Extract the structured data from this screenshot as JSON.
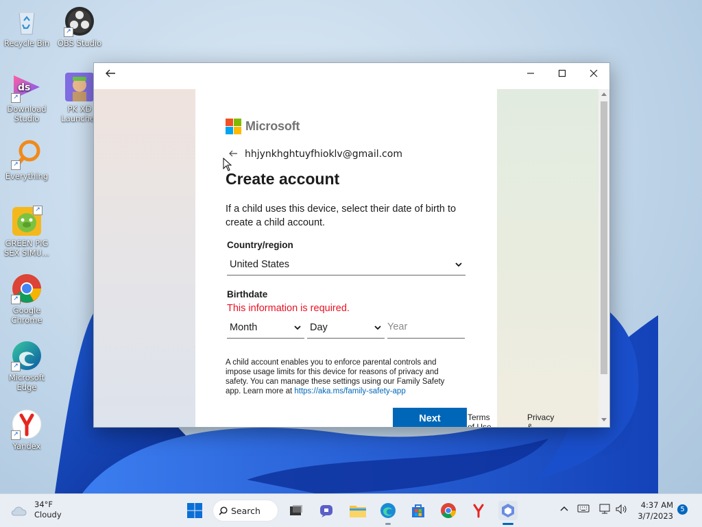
{
  "desktop": {
    "icons": [
      {
        "label": "Recycle Bin"
      },
      {
        "label": "OBS Studio"
      },
      {
        "label": "Download Studio"
      },
      {
        "label": "PK XD Launcher"
      },
      {
        "label": "Everything"
      },
      {
        "label": "GREEN PIG SEX SIMU..."
      },
      {
        "label": "Google Chrome"
      },
      {
        "label": "Microsoft Edge"
      },
      {
        "label": "Yandex"
      }
    ]
  },
  "window": {
    "brand": "Microsoft",
    "identity_email": "hhjynkhghtuyfhioklv@gmail.com",
    "title": "Create account",
    "description": "If a child uses this device, select their date of birth to create a child account.",
    "country_label": "Country/region",
    "country_value": "United States",
    "birthdate_label": "Birthdate",
    "error_text": "This information is required.",
    "month_value": "Month",
    "day_value": "Day",
    "year_placeholder": "Year",
    "fine_print": "A child account enables you to enforce parental controls and impose usage limits for this device for reasons of privacy and safety. You can manage these settings using our Family Safety app. Learn more at ",
    "fine_print_link": "https://aka.ms/family-safety-app",
    "next_label": "Next",
    "terms_label": "Terms of Use",
    "privacy_label": "Privacy & Cookies"
  },
  "taskbar": {
    "weather_temp": "34°F",
    "weather_desc": "Cloudy",
    "search_label": "Search",
    "time": "4:37 AM",
    "date": "3/7/2023",
    "notification_count": "5"
  },
  "colors": {
    "accent": "#0067b8",
    "error": "#e81123",
    "ms_red": "#f25022",
    "ms_green": "#7fba00",
    "ms_blue": "#00a4ef",
    "ms_yellow": "#ffb900"
  }
}
